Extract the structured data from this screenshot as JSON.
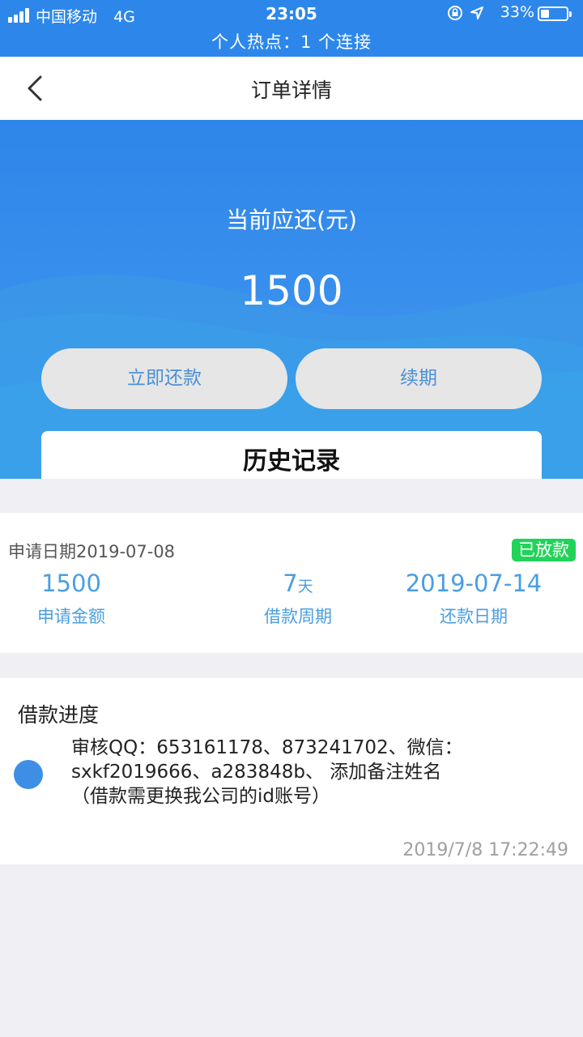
{
  "status_bar": {
    "carrier": "中国移动",
    "network": "4G",
    "time": "23:05",
    "battery_percent": "33%",
    "battery_level": 0.33,
    "hotspot": "个人热点：1 个连接",
    "icons": [
      "signal-icon",
      "rotation-lock-icon",
      "location-icon",
      "battery-icon"
    ]
  },
  "nav": {
    "title": "订单详情",
    "back_icon": "chevron-left-icon"
  },
  "hero": {
    "label": "当前应还(元)",
    "amount": "1500",
    "repay_label": "立即还款",
    "renew_label": "续期",
    "history_label": "历史记录"
  },
  "summary": {
    "apply_date": "申请日期2019-07-08",
    "status": "已放款",
    "amount_value": "1500",
    "amount_label": "申请金额",
    "period_value": "7",
    "period_unit": "天",
    "period_label": "借款周期",
    "due_value": "2019-07-14",
    "due_label": "还款日期"
  },
  "progress": {
    "title": "借款进度",
    "line1": "审核QQ：653161178、873241702、微信：",
    "line2": "sxkf2019666、a283848b、 添加备注姓名",
    "line3": "（借款需更换我公司的id账号）",
    "time": "2019/7/8 17:22:49"
  },
  "colors": {
    "primary": "#2d87ea",
    "accent_text": "#4a9ee2",
    "badge": "#22d35a",
    "dot": "#3e8ee6"
  }
}
